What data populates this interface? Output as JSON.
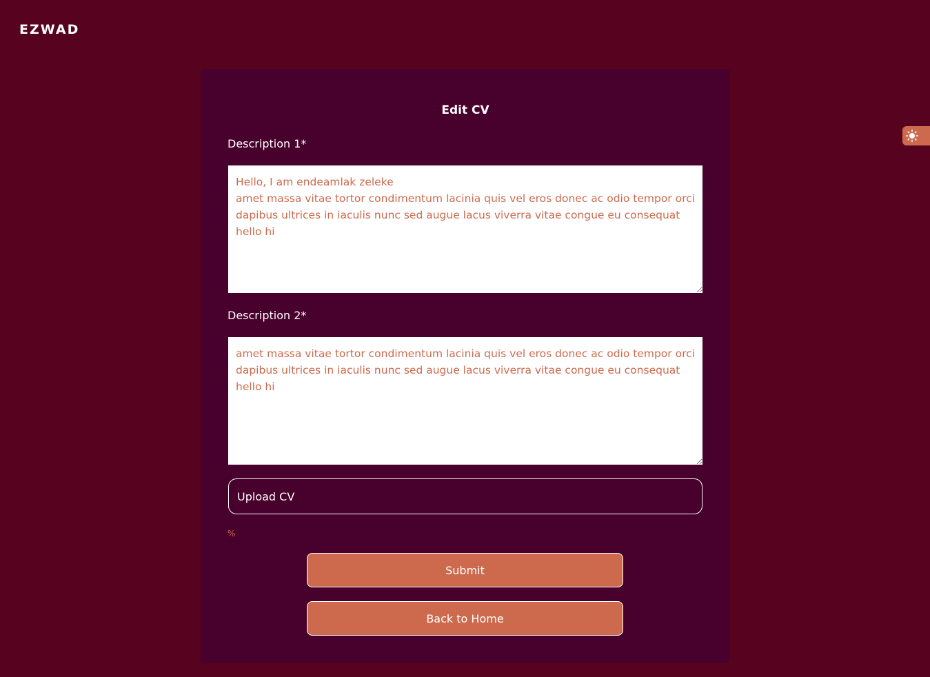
{
  "header": {
    "logo": "EZWAD"
  },
  "theme_toggle": {
    "icon": "sun-icon"
  },
  "form": {
    "title": "Edit CV",
    "description1": {
      "label": "Description 1*",
      "value": "Hello, I am endeamlak zeleke\namet massa vitae tortor condimentum lacinia quis vel eros donec ac odio tempor orci dapibus ultrices in iaculis nunc sed augue lacus viverra vitae congue eu consequat hello hi"
    },
    "description2": {
      "label": "Description 2*",
      "value": "amet massa vitae tortor condimentum lacinia quis vel eros donec ac odio tempor orci dapibus ultrices in iaculis nunc sed augue lacus viverra vitae congue eu consequat hello hi"
    },
    "upload_label": "Upload CV",
    "progress_text": "%",
    "submit_label": "Submit",
    "back_label": "Back to Home"
  },
  "colors": {
    "background": "#57021e",
    "card": "#48002c",
    "accent": "#cd6a4e",
    "text": "#ffffff"
  }
}
